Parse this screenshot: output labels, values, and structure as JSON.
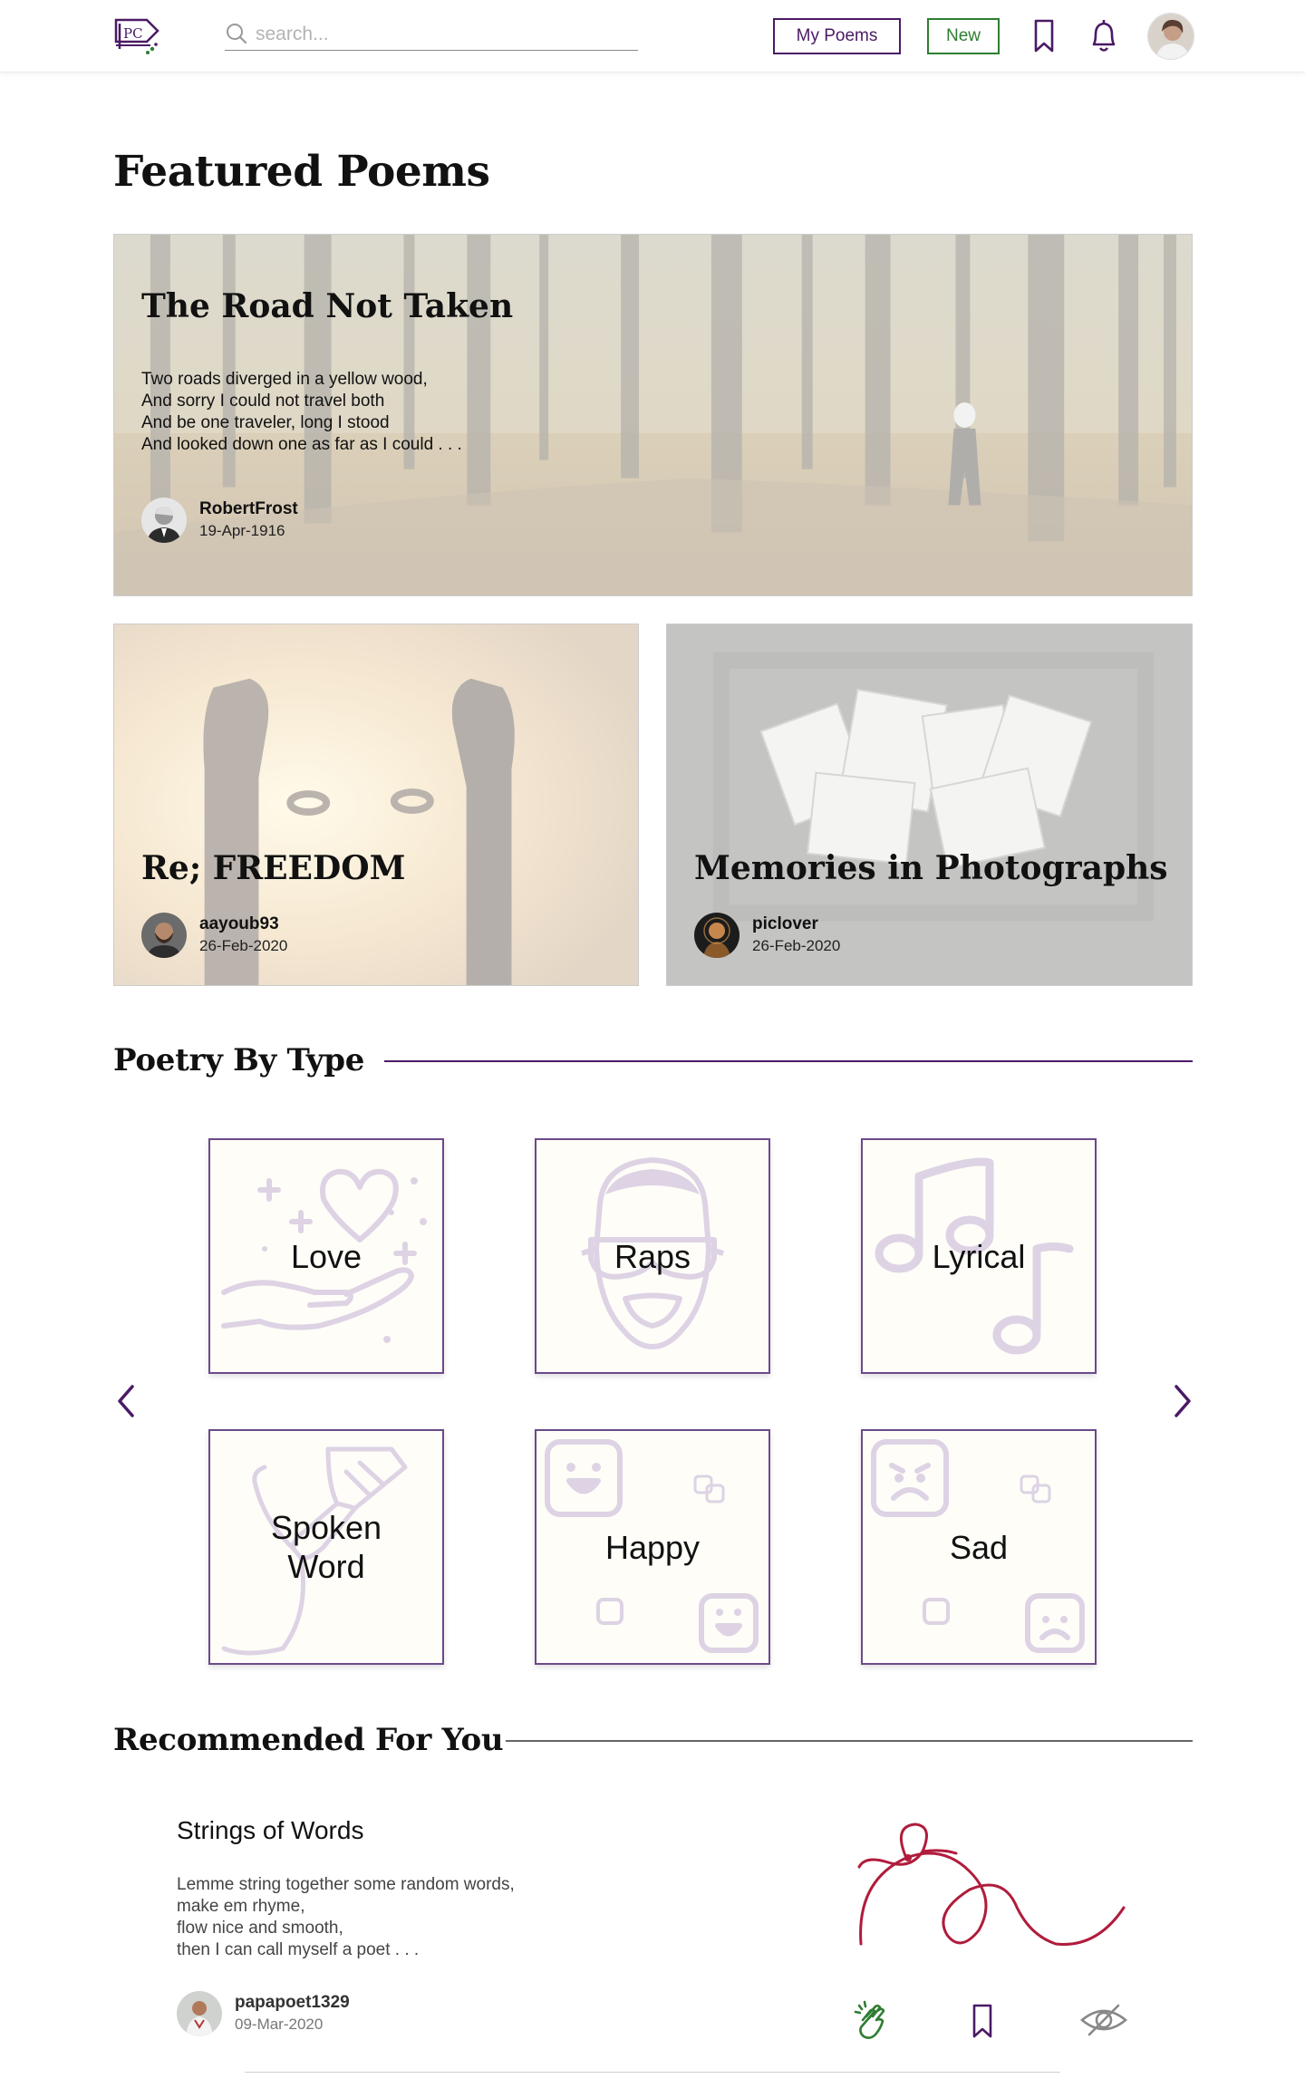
{
  "header": {
    "logo_text": "PC",
    "search_placeholder": "search...",
    "my_poems_label": "My Poems",
    "new_label": "New",
    "icons": [
      "search-icon",
      "bookmark-icon",
      "bell-icon",
      "user-avatar"
    ],
    "colors": {
      "brand": "#4b1a66",
      "new": "#2e7d32"
    }
  },
  "featured": {
    "heading": "Featured Poems",
    "main": {
      "title": "The Road Not Taken",
      "excerpt": [
        "Two roads diverged in a yellow wood,",
        "And sorry I could not travel both",
        "And be one traveler, long I stood",
        "And looked down one as far as I could . . ."
      ],
      "author": "RobertFrost",
      "date": "19-Apr-1916"
    },
    "cards": [
      {
        "title": "Re; FREEDOM",
        "author": "aayoub93",
        "date": "26-Feb-2020"
      },
      {
        "title": "Memories in Photographs",
        "author": "piclover",
        "date": "26-Feb-2020"
      }
    ]
  },
  "types": {
    "heading": "Poetry By Type",
    "items": [
      {
        "label": "Love"
      },
      {
        "label": "Raps"
      },
      {
        "label": "Lyrical"
      },
      {
        "label": "Spoken Word"
      },
      {
        "label": "Happy"
      },
      {
        "label": "Sad"
      }
    ]
  },
  "recommended": {
    "heading": "Recommended For You",
    "title": "Strings of Words",
    "excerpt": [
      "Lemme string together some random words,",
      "make em rhyme,",
      "flow nice and smooth,",
      "then I can call myself a poet . . ."
    ],
    "author": "papapoet1329",
    "date": "09-Mar-2020",
    "actions": [
      "clap-icon",
      "bookmark-icon",
      "eye-slash-icon"
    ]
  }
}
